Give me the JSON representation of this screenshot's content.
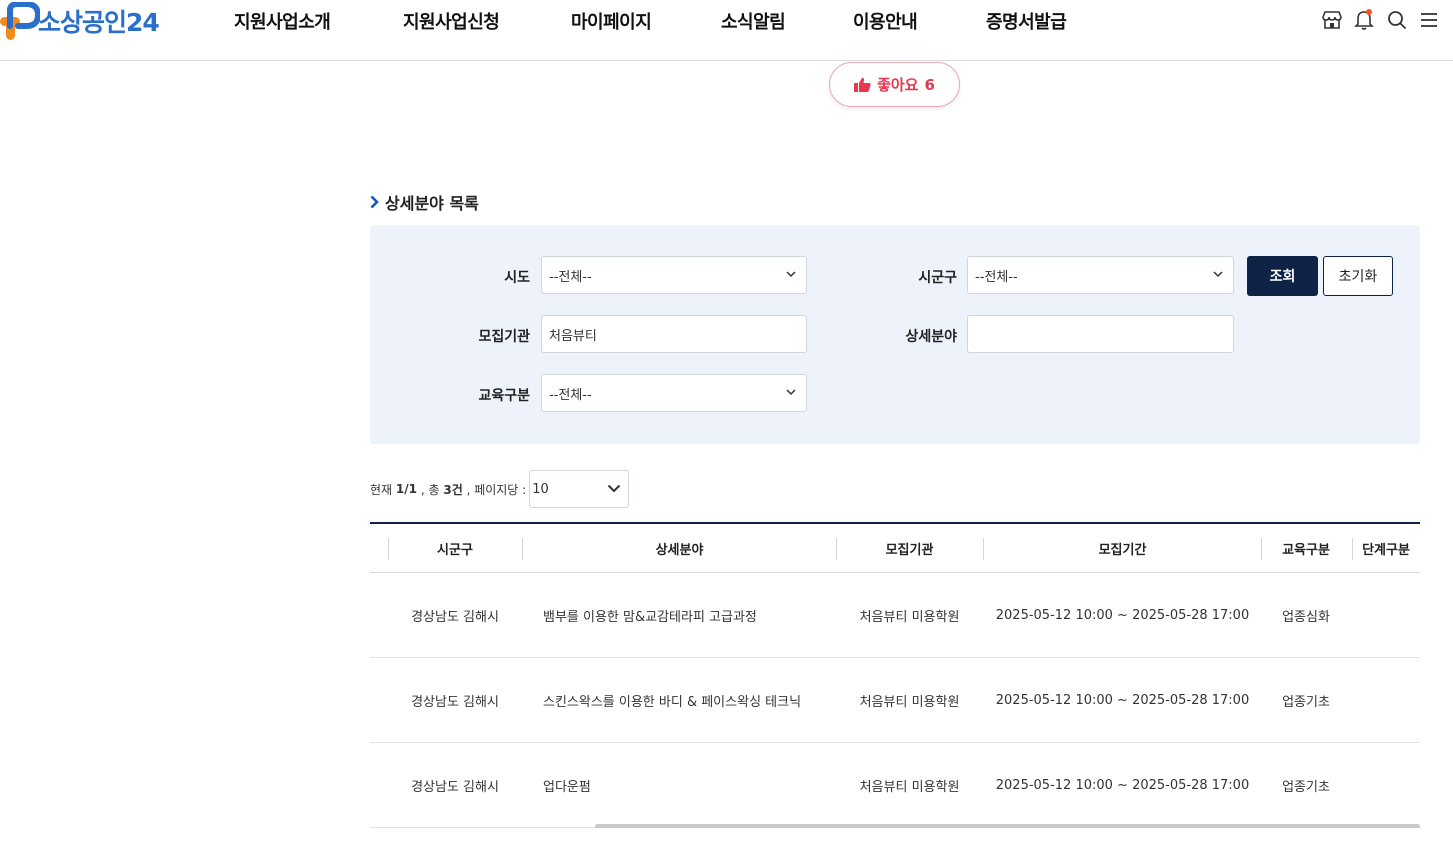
{
  "header": {
    "logo_text": "소상공인24",
    "nav": [
      "지원사업소개",
      "지원사업신청",
      "마이페이지",
      "소식알림",
      "이용안내",
      "증명서발급"
    ],
    "icons": [
      "store-icon",
      "bell-icon",
      "search-icon",
      "menu-icon"
    ]
  },
  "like": {
    "label": "좋아요",
    "count": "6",
    "icon": "thumbs-up-icon"
  },
  "section": {
    "title": "상세분야 목록"
  },
  "filter": {
    "sido_label": "시도",
    "sido_value": "--전체--",
    "sigungu_label": "시군구",
    "sigungu_value": "--전체--",
    "agency_label": "모집기관",
    "agency_value": "처음뷰티",
    "field_label": "상세분야",
    "field_value": "",
    "edu_label": "교육구분",
    "edu_value": "--전체--",
    "search_label": "조회",
    "reset_label": "초기화"
  },
  "summary": {
    "prefix": "현재",
    "page": "1/1",
    "total_prefix": ", 총",
    "total": "3건",
    "perpage_label": ", 페이지당 :",
    "perpage_value": "10"
  },
  "table": {
    "headers": [
      "시군구",
      "상세분야",
      "모집기관",
      "모집기간",
      "교육구분",
      "단계구분"
    ],
    "rows": [
      {
        "sigungu": "경상남도 김해시",
        "field": "뱀부를 이용한 맘&교감테라피 고급과정",
        "agency": "처음뷰티 미용학원",
        "period": "2025-05-12 10:00 ~ 2025-05-28 17:00",
        "edu": "업종심화"
      },
      {
        "sigungu": "경상남도 김해시",
        "field": "스킨스왁스를 이용한 바디 & 페이스왁싱 테크닉",
        "agency": "처음뷰티 미용학원",
        "period": "2025-05-12 10:00 ~ 2025-05-28 17:00",
        "edu": "업종기초"
      },
      {
        "sigungu": "경상남도 김해시",
        "field": "업다운펌",
        "agency": "처음뷰티 미용학원",
        "period": "2025-05-12 10:00 ~ 2025-05-28 17:00",
        "edu": "업종기초"
      }
    ]
  },
  "colors": {
    "brand_blue": "#2a6fc9",
    "brand_orange": "#f28a1e",
    "navy": "#0f2346",
    "like_red": "#e8384f",
    "panel_bg": "#eef3fb"
  }
}
